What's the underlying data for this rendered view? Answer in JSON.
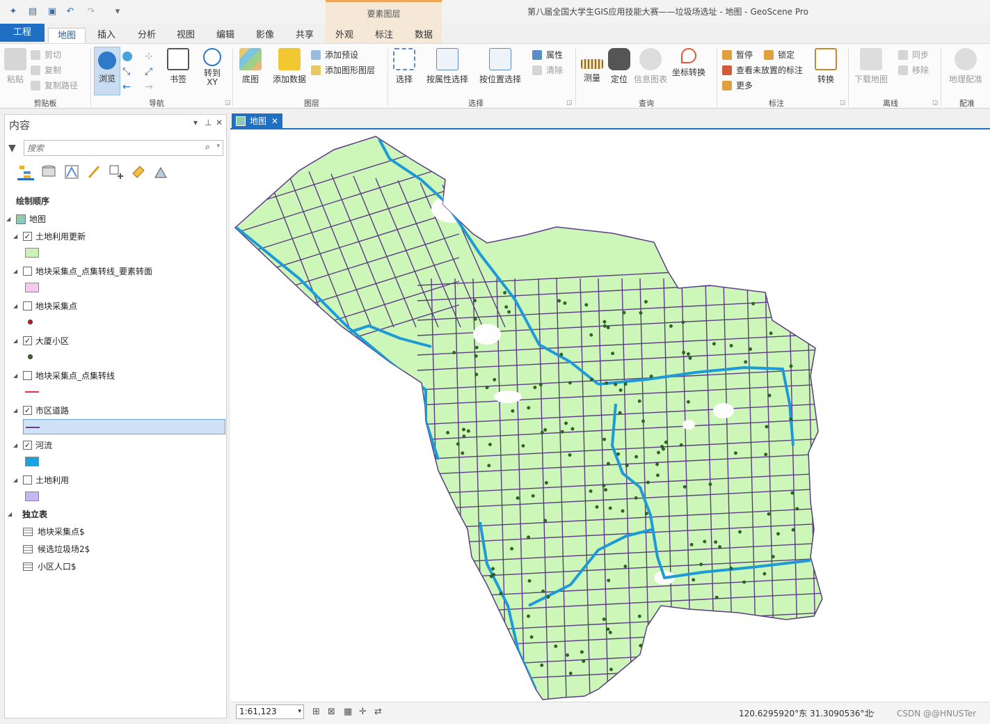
{
  "app": {
    "window_title": "第八届全国大学生GIS应用技能大赛——垃圾场选址 - 地图 - GeoScene Pro",
    "context_group": "要素图层",
    "accent_color": "#1f6fc5"
  },
  "tabs": [
    "工程",
    "地图",
    "插入",
    "分析",
    "视图",
    "编辑",
    "影像",
    "共享",
    "外观",
    "标注",
    "数据"
  ],
  "ribbon": {
    "clipboard": {
      "paste": "粘贴",
      "cut": "剪切",
      "copy": "复制",
      "copy_path": "复制路径",
      "group": "剪贴板"
    },
    "navigate": {
      "explore": "浏览",
      "bookmarks": "书签",
      "goto": "转到\nXY",
      "group": "导航"
    },
    "layer": {
      "basemap": "底图",
      "add_data": "添加数据",
      "add_preset": "添加预设",
      "add_graphics": "添加图形图层",
      "group": "图层"
    },
    "selection": {
      "select": "选择",
      "by_attr": "按属性选择",
      "by_loc": "按位置选择",
      "attributes": "属性",
      "clear": "清除",
      "group": "选择"
    },
    "inquiry": {
      "measure": "测量",
      "locate": "定位",
      "infographics": "信息图表",
      "coord_convert": "坐标转换",
      "group": "查询"
    },
    "labeling": {
      "pause": "暂停",
      "lock": "锁定",
      "view_unplaced": "查看未放置的标注",
      "more": "更多",
      "convert": "转换",
      "group": "标注"
    },
    "offline": {
      "download_map": "下载地图",
      "sync": "同步",
      "remove": "移除",
      "group": "离线"
    },
    "georef": {
      "georeference": "地理配准",
      "group": "配准"
    }
  },
  "contents": {
    "title": "内容",
    "search_placeholder": "搜索",
    "draw_order": "绘制顺序",
    "map_name": "地图",
    "layers": [
      {
        "name": "土地利用更新",
        "checked": true,
        "swatch": "#cdf2b8",
        "type": "poly"
      },
      {
        "name": "地块采集点_点集转线_要素转面",
        "checked": false,
        "swatch": "#f5c9ee",
        "type": "poly"
      },
      {
        "name": "地块采集点",
        "checked": false,
        "swatch": "#e0101a",
        "type": "point"
      },
      {
        "name": "大厦小区",
        "checked": true,
        "swatch": "#3a6e2a",
        "type": "point"
      },
      {
        "name": "地块采集点_点集转线",
        "checked": false,
        "swatch": "#e0303a",
        "type": "line"
      },
      {
        "name": "市区道路",
        "checked": true,
        "swatch": "#6a3a8a",
        "type": "line"
      },
      {
        "name": "河流",
        "checked": true,
        "swatch": "#1aa3e0",
        "type": "poly"
      },
      {
        "name": "土地利用",
        "checked": false,
        "swatch": "#c6b6f3",
        "type": "poly"
      }
    ],
    "standalone_title": "独立表",
    "tables": [
      "地块采集点$",
      "候选垃圾场2$",
      "小区人口$"
    ]
  },
  "map_view": {
    "tab_label": "地图",
    "land_color": "#cdf7b8",
    "road_color": "#5b3a86",
    "river_color": "#1e9ad6"
  },
  "status": {
    "scale": "1:61,123",
    "coordinates": "120.6295920°东 31.3090536°北",
    "watermark": "CSDN @@HNUSTer"
  }
}
